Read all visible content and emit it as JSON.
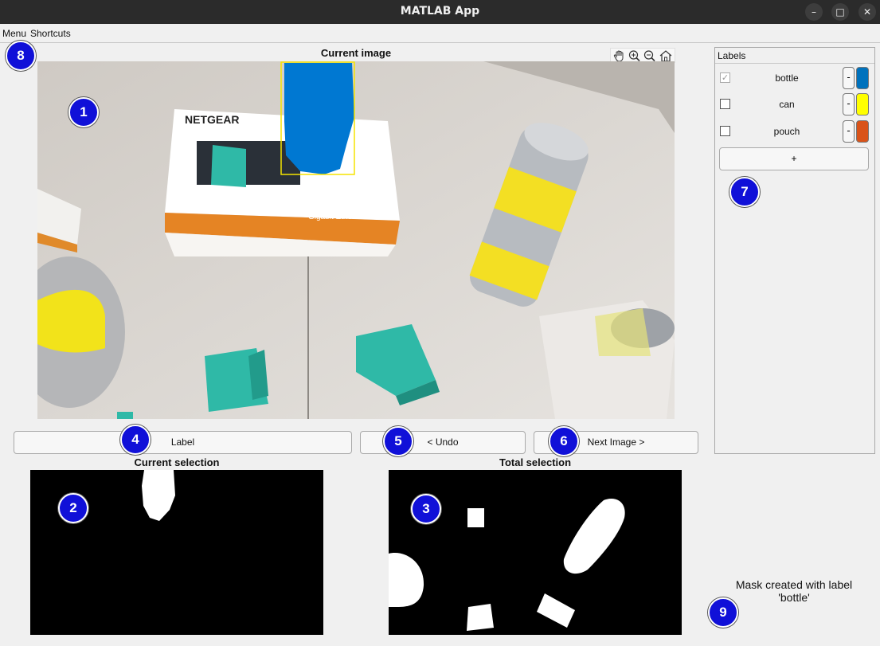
{
  "window": {
    "title": "MATLAB App",
    "minimize_glyph": "–",
    "maximize_glyph": "□",
    "close_glyph": "✕"
  },
  "menu": {
    "items": [
      "Menu",
      "Shortcuts"
    ]
  },
  "current_image": {
    "title": "Current image"
  },
  "toolbar": {
    "icons": [
      "pan-hand-icon",
      "zoom-in-icon",
      "zoom-out-icon",
      "home-icon"
    ]
  },
  "buttons": {
    "label": "Label",
    "undo": "< Undo",
    "next": "Next Image >"
  },
  "current_selection": {
    "title": "Current selection"
  },
  "total_selection": {
    "title": "Total selection"
  },
  "labels_panel": {
    "title": "Labels",
    "items": [
      {
        "name": "bottle",
        "checked": true,
        "color": "#0072BD"
      },
      {
        "name": "can",
        "checked": false,
        "color": "#FFFF00"
      },
      {
        "name": "pouch",
        "checked": false,
        "color": "#D95319"
      }
    ],
    "remove_label": "-",
    "add_label": "+"
  },
  "status": {
    "line1": "Mask created with label",
    "line2": "'bottle'"
  },
  "badges": [
    "1",
    "2",
    "3",
    "4",
    "5",
    "6",
    "7",
    "8",
    "9"
  ]
}
